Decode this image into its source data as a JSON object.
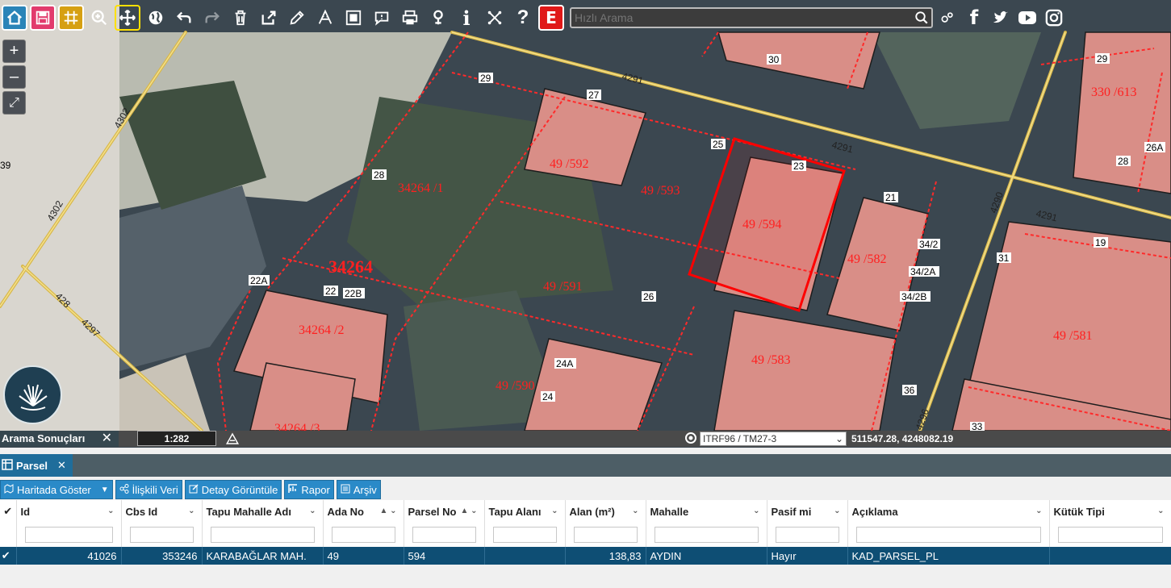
{
  "toolbar": {
    "search_placeholder": "Hızlı Arama",
    "info_label": "i",
    "help_label": "?",
    "e_label": "E",
    "facebook_label": "f"
  },
  "map": {
    "parcels": [
      {
        "label": "49 /592"
      },
      {
        "label": "49 /593"
      },
      {
        "label": "49 /594"
      },
      {
        "label": "49 /582"
      },
      {
        "label": "34264 /1"
      },
      {
        "label": "34264"
      },
      {
        "label": "49 /591"
      },
      {
        "label": "34264 /2"
      },
      {
        "label": "49 /583"
      },
      {
        "label": "49 /581"
      },
      {
        "label": "49 /590"
      },
      {
        "label": "34264 /3"
      },
      {
        "label": "330 /613"
      },
      {
        "label": "49"
      }
    ],
    "door_numbers": [
      "29",
      "27",
      "30",
      "25",
      "23",
      "21",
      "28",
      "22A",
      "22",
      "22B",
      "26",
      "34/2",
      "34/2A",
      "34/2B",
      "31",
      "19",
      "24A",
      "24",
      "36",
      "33",
      "29",
      "28",
      "26A",
      "39"
    ],
    "road_labels": [
      "4291",
      "4291",
      "4291",
      "4302",
      "4302",
      "4297",
      "428",
      "4290",
      "4296"
    ]
  },
  "status": {
    "results_label": "Arama Sonuçları",
    "close": "✕",
    "scale": "1:282",
    "crs": "ITRF96 / TM27-3",
    "coords": "511547.28, 4248082.19"
  },
  "panel": {
    "tab_label": "Parsel",
    "tab_close": "✕",
    "actions": {
      "show_on_map": "Haritada Göster",
      "related_data": "İlişkili Veri",
      "detail_view": "Detay Görüntüle",
      "report": "Rapor",
      "archive": "Arşiv"
    },
    "columns": [
      "Id",
      "Cbs Id",
      "Tapu Mahalle Adı",
      "Ada No",
      "Parsel No",
      "Tapu Alanı",
      "Alan (m²)",
      "Mahalle",
      "Pasif mi",
      "Açıklama",
      "Kütük Tipi"
    ],
    "row": {
      "id": "41026",
      "cbs_id": "353246",
      "tapu_mahalle": "KARABAĞLAR MAH.",
      "ada_no": "49",
      "parsel_no": "594",
      "tapu_alani": "",
      "alan": "138,83",
      "mahalle": "AYDIN",
      "pasif": "Hayır",
      "aciklama": "KAD_PARSEL_PL",
      "kutuk_tipi": ""
    }
  }
}
